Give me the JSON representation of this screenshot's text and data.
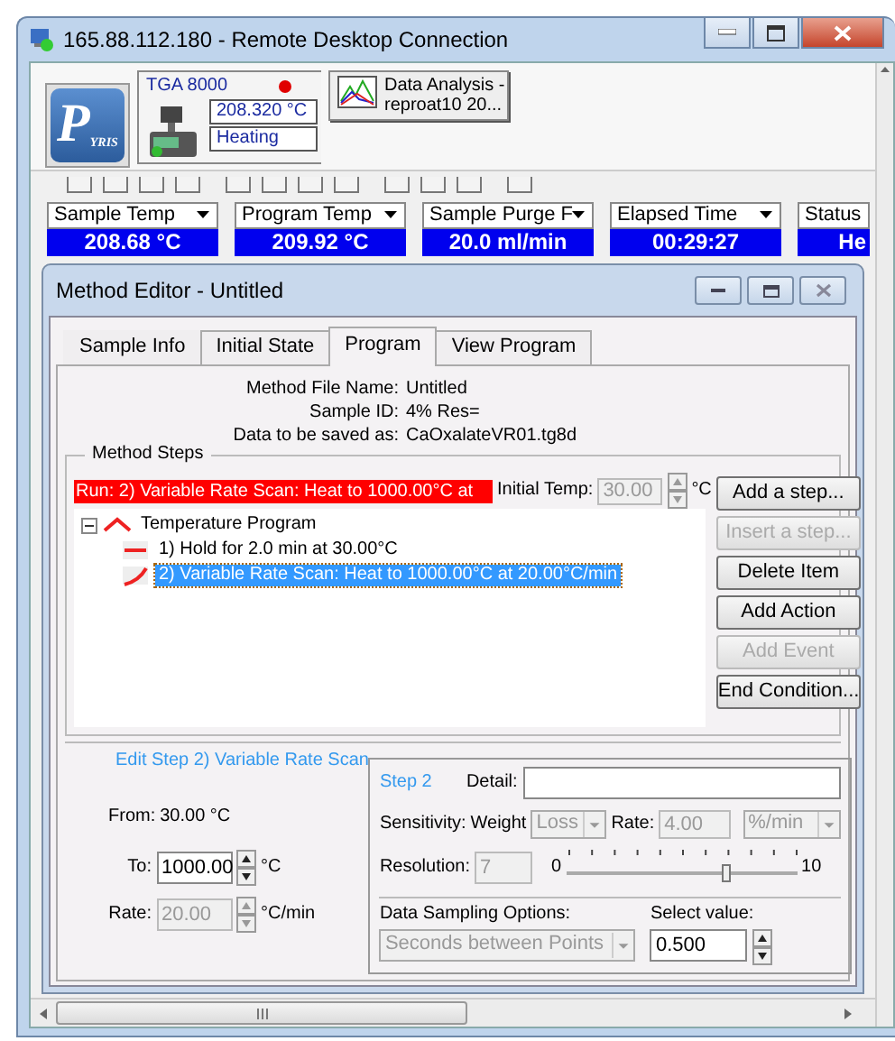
{
  "window": {
    "title": "165.88.112.180 - Remote Desktop Connection"
  },
  "logo": {
    "initial": "P",
    "rest": "YRIS"
  },
  "instrument": {
    "name": "TGA 8000",
    "temperature": "208.320 °C",
    "state": "Heating"
  },
  "analysis_button": {
    "lines": [
      "Data Analysis -",
      "reproat10 20..."
    ]
  },
  "readouts": [
    {
      "label": "Sample Temp",
      "value": "208.68 °C"
    },
    {
      "label": "Program Temp",
      "value": "209.92 °C"
    },
    {
      "label": "Sample Purge F",
      "value": "20.0 ml/min"
    },
    {
      "label": "Elapsed Time",
      "value": "00:29:27"
    },
    {
      "label": "Status",
      "value": "He"
    }
  ],
  "method_editor": {
    "title": "Method Editor - Untitled",
    "tabs": [
      {
        "label": "Sample Info",
        "selected": false
      },
      {
        "label": "Initial State",
        "selected": false
      },
      {
        "label": "Program",
        "selected": true
      },
      {
        "label": "View Program",
        "selected": false
      }
    ],
    "info": [
      {
        "label": "Method File Name:",
        "value": "Untitled"
      },
      {
        "label": "Sample ID:",
        "value": "4%  Res="
      },
      {
        "label": "Data to be saved as:",
        "value": "CaOxalateVR01.tg8d"
      }
    ],
    "method_steps": {
      "title": "Method Steps",
      "run_banner": "Run: 2) Variable Rate Scan: Heat to 1000.00°C at",
      "initial_temp": {
        "label": "Initial Temp:",
        "value": "30.00",
        "unit": "°C",
        "disabled": true
      },
      "tree": [
        {
          "label": "Temperature Program",
          "expanded": true,
          "selected": false,
          "children": [
            {
              "label": "1) Hold for 2.0 min at 30.00°C",
              "kind": "hold",
              "selected": false
            },
            {
              "label": "2) Variable Rate Scan: Heat to 1000.00°C at 20.00°C/min",
              "kind": "ramp",
              "selected": true
            }
          ]
        }
      ],
      "buttons": [
        {
          "label": "Add a step...",
          "disabled": false
        },
        {
          "label": "Insert a step...",
          "disabled": true
        },
        {
          "label": "Delete Item",
          "disabled": false
        },
        {
          "label": "Add Action",
          "disabled": false
        },
        {
          "label": "Add Event",
          "disabled": true
        },
        {
          "label": "End Condition...",
          "disabled": false
        }
      ]
    },
    "edit_step": {
      "title": "Edit Step 2)  Variable Rate Scan",
      "from": {
        "label": "From:",
        "value": "30.00 °C"
      },
      "fields": [
        {
          "label": "To:",
          "value": "1000.00",
          "unit": "°C",
          "disabled": false
        },
        {
          "label": "Rate:",
          "value": "20.00",
          "unit": "°C/min",
          "disabled": true
        }
      ],
      "step_box": {
        "title": "Step 2",
        "detail_label": "Detail:",
        "sensitivity": {
          "label": "Sensitivity:",
          "weight_label": "Weight",
          "weight_value": "Loss",
          "weight_disabled": true,
          "rate_label": "Rate:",
          "rate_value": "4.00",
          "rate_disabled": true,
          "unit_value": "%/min",
          "unit_disabled": true
        },
        "resolution": {
          "label": "Resolution:",
          "value": "7",
          "disabled": true,
          "min": "0",
          "max": "10",
          "level": 0.7
        },
        "sampling": {
          "label": "Data Sampling Options:",
          "option": "Seconds between Points",
          "option_disabled": true,
          "value_label": "Select value:",
          "value": "0.500"
        }
      }
    }
  }
}
